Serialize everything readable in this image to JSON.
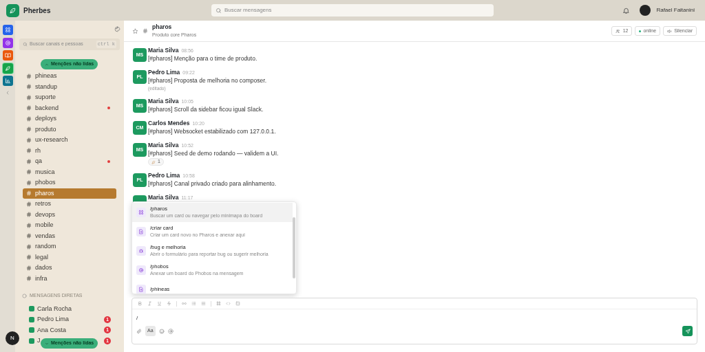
{
  "app": {
    "name": "Pherbes"
  },
  "search": {
    "placeholder": "Buscar mensagens"
  },
  "user": {
    "name": "Rafael Faitanini"
  },
  "rail": [
    {
      "kind": "grid",
      "color": "#2563eb",
      "selected": false
    },
    {
      "kind": "target",
      "color": "#9333ea",
      "selected": false
    },
    {
      "kind": "book",
      "color": "#ea580c",
      "selected": false
    },
    {
      "kind": "leaf",
      "color": "#16a34a",
      "selected": true
    },
    {
      "kind": "chart",
      "color": "#0e7490",
      "selected": false
    }
  ],
  "sidebar": {
    "search_placeholder": "Buscar canais e pessoas",
    "shortcut": "ctrl k",
    "mentions_top": "Menções não lidas",
    "channels": [
      {
        "name": "phineas",
        "selected": false,
        "unread": false
      },
      {
        "name": "standup",
        "selected": false,
        "unread": false
      },
      {
        "name": "suporte",
        "selected": false,
        "unread": false
      },
      {
        "name": "backend",
        "selected": false,
        "unread": true
      },
      {
        "name": "deploys",
        "selected": false,
        "unread": false
      },
      {
        "name": "produto",
        "selected": false,
        "unread": false
      },
      {
        "name": "ux-research",
        "selected": false,
        "unread": false
      },
      {
        "name": "rh",
        "selected": false,
        "unread": false
      },
      {
        "name": "qa",
        "selected": false,
        "unread": true
      },
      {
        "name": "musica",
        "selected": false,
        "unread": false
      },
      {
        "name": "phobos",
        "selected": false,
        "unread": false
      },
      {
        "name": "pharos",
        "selected": true,
        "unread": false
      },
      {
        "name": "retros",
        "selected": false,
        "unread": false
      },
      {
        "name": "devops",
        "selected": false,
        "unread": false
      },
      {
        "name": "mobile",
        "selected": false,
        "unread": false
      },
      {
        "name": "vendas",
        "selected": false,
        "unread": false
      },
      {
        "name": "random",
        "selected": false,
        "unread": false
      },
      {
        "name": "legal",
        "selected": false,
        "unread": false
      },
      {
        "name": "dados",
        "selected": false,
        "unread": false
      },
      {
        "name": "infra",
        "selected": false,
        "unread": false
      }
    ],
    "dm_header": "MENSAGENS DIRETAS",
    "dms": [
      {
        "name": "Carla Rocha"
      },
      {
        "name": "Pedro Lima",
        "badge": "1"
      },
      {
        "name": "Ana Costa",
        "badge": "1"
      },
      {
        "name": "J",
        "badge": "1"
      }
    ],
    "mentions_bottom": "Menções não lidas",
    "account_initial": "N"
  },
  "channel": {
    "name": "pharos",
    "description": "Produto core Pharos",
    "members": "12",
    "status": "online",
    "mute": "Silenciar"
  },
  "messages": [
    {
      "initials": "MS",
      "author": "Maria Silva",
      "time": "08:56",
      "text": "[#pharos] Menção para o time de produto."
    },
    {
      "initials": "PL",
      "author": "Pedro Lima",
      "time": "09:22",
      "text": "[#pharos] Proposta de melhoria no composer.",
      "edited": "(editado)"
    },
    {
      "initials": "MS",
      "author": "Maria Silva",
      "time": "10:05",
      "text": "[#pharos] Scroll da sidebar ficou igual Slack."
    },
    {
      "initials": "CM",
      "author": "Carlos Mendes",
      "time": "10:20",
      "text": "[#pharos] Websocket estabilizado com 127.0.0.1."
    },
    {
      "initials": "MS",
      "author": "Maria Silva",
      "time": "10:52",
      "text": "[#pharos] Seed de demo rodando — validem a UI.",
      "reaction": "1"
    },
    {
      "initials": "PL",
      "author": "Pedro Lima",
      "time": "10:58",
      "text": "[#pharos] Canal privado criado para alinhamento."
    },
    {
      "author": "Maria Silva",
      "time": "11:17"
    }
  ],
  "commands": [
    {
      "kind": "grid",
      "name": "/pharos",
      "description": "Buscar um card ou navegar pelo minimapa do board",
      "selected": true
    },
    {
      "kind": "file",
      "name": "/criar card",
      "description": "Criar um card novo no Pharos e anexar aqui",
      "selected": false
    },
    {
      "kind": "bug",
      "name": "/bug e melhoria",
      "description": "Abrir o formulário para reportar bug ou sugerir melhoria",
      "selected": false
    },
    {
      "kind": "target",
      "name": "/phobos",
      "description": "Anexar um board do Phobos na mensagem",
      "selected": false
    },
    {
      "kind": "file",
      "name": "/phineas",
      "selected": false
    }
  ],
  "composer": {
    "value": "/",
    "format_label": "Aa",
    "format_selected": true
  }
}
